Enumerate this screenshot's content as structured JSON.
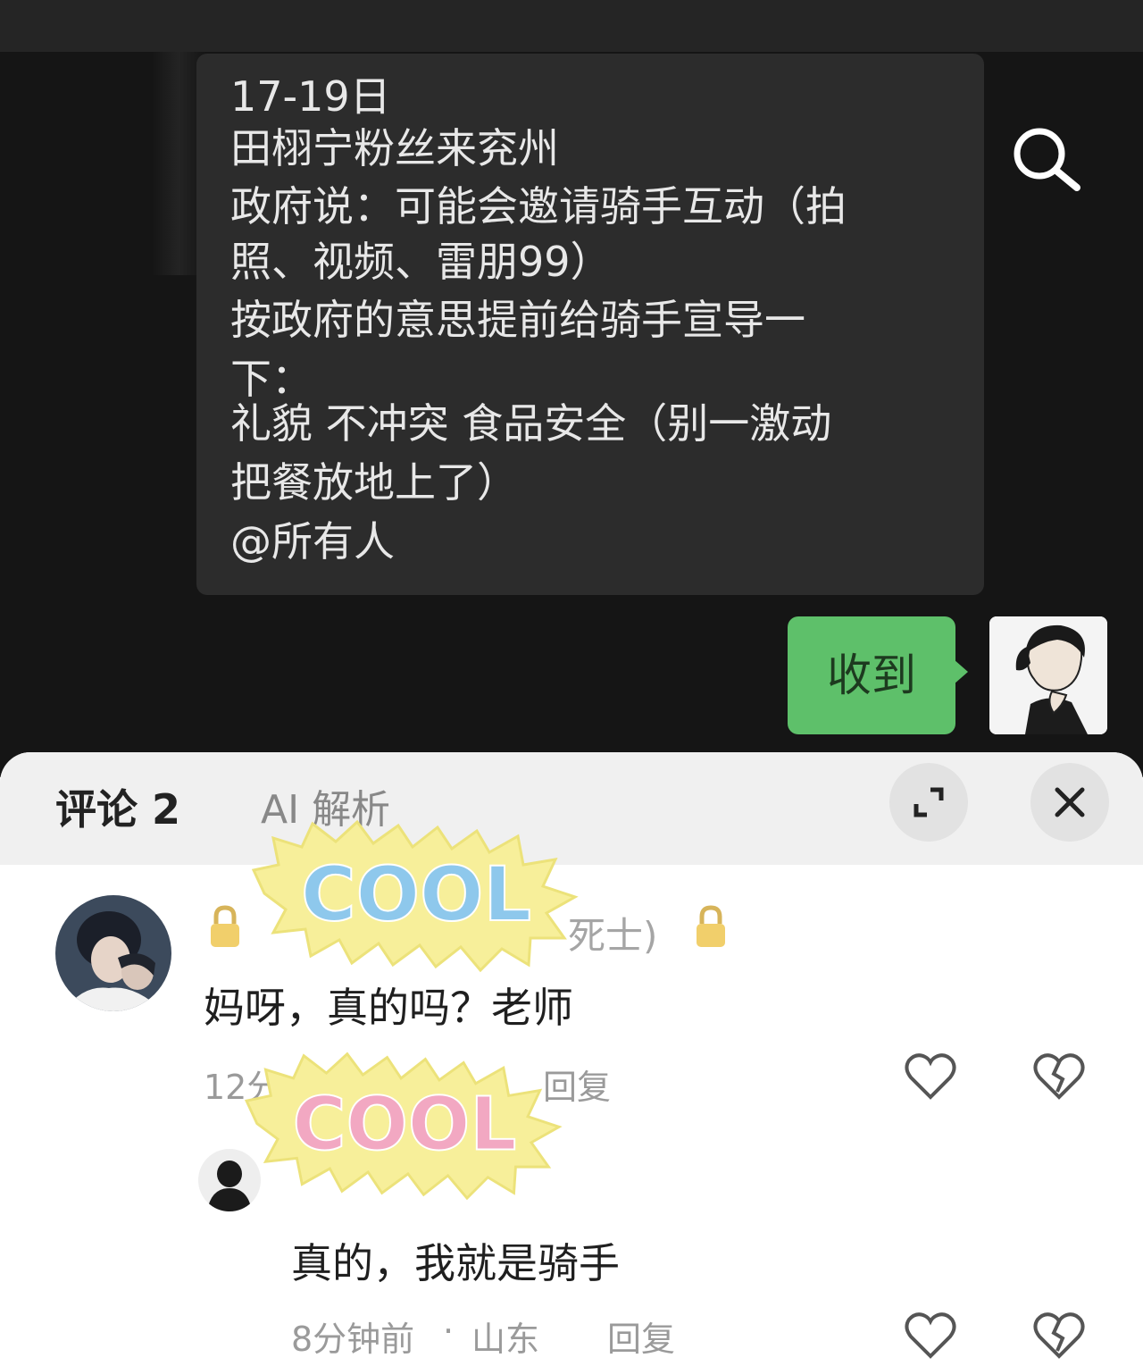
{
  "chat": {
    "message_lines": [
      "17-19日",
      "田栩宁粉丝来兖州",
      "政府说：可能会邀请骑手互动（拍",
      "照、视频、雷朋99）",
      "按政府的意思提前给骑手宣导一",
      "下：",
      "礼貌 不冲突 食品安全（别一激动",
      "把餐放地上了）",
      "@所有人"
    ],
    "reply": "收到"
  },
  "comments_panel": {
    "tab_comments": "评论 2",
    "tab_ai": "AI 解析",
    "sticker_text": "COOL",
    "comment1": {
      "author_fragment": "死士)",
      "text": "妈呀，真的吗？老师",
      "time_fragment": "12分",
      "reply_label": "回复"
    },
    "comment2": {
      "text": "真的，我就是骑手",
      "time": "8分钟前",
      "location": "山东",
      "separator": "·",
      "reply_label": "回复"
    }
  },
  "colors": {
    "chat_bg": "#151515",
    "bubble_bg": "#2c2c2c",
    "reply_bubble": "#5ec06a",
    "panel_bg": "#ffffff",
    "sticker_bg": "#f7ef9a"
  },
  "icons": [
    "search-icon",
    "expand-icon",
    "close-icon",
    "heart-icon",
    "broken-heart-icon",
    "lock-icon"
  ]
}
